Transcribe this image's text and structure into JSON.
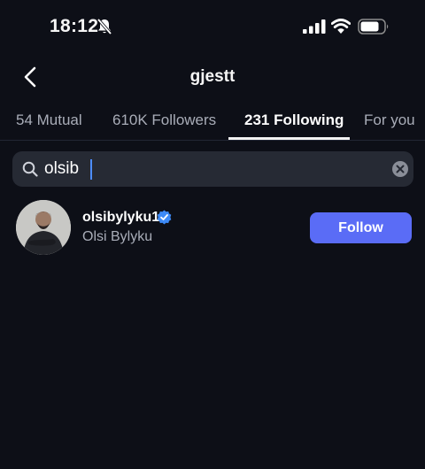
{
  "status_bar": {
    "time": "18:12",
    "icons": [
      "bell-slash-icon",
      "cellular-signal-icon",
      "wifi-icon",
      "battery-icon"
    ]
  },
  "header": {
    "title": "gjestt",
    "back_icon": "chevron-left-icon"
  },
  "tabs": [
    {
      "label": "54 Mutual",
      "active": false
    },
    {
      "label": "610K Followers",
      "active": false
    },
    {
      "label": "231 Following",
      "active": true
    },
    {
      "label": "For you",
      "active": false
    }
  ],
  "search": {
    "value": "olsib",
    "icon": "search-icon",
    "clear_icon": "clear-icon"
  },
  "results": [
    {
      "username": "olsibylyku1",
      "full_name": "Olsi Bylyku",
      "verified": true,
      "button_label": "Follow"
    }
  ],
  "colors": {
    "background": "#0d0f17",
    "search_bg": "#262a34",
    "follow_button": "#5a6cf6",
    "verified_badge": "#3d8af7",
    "secondary_text": "#a9adb8"
  }
}
